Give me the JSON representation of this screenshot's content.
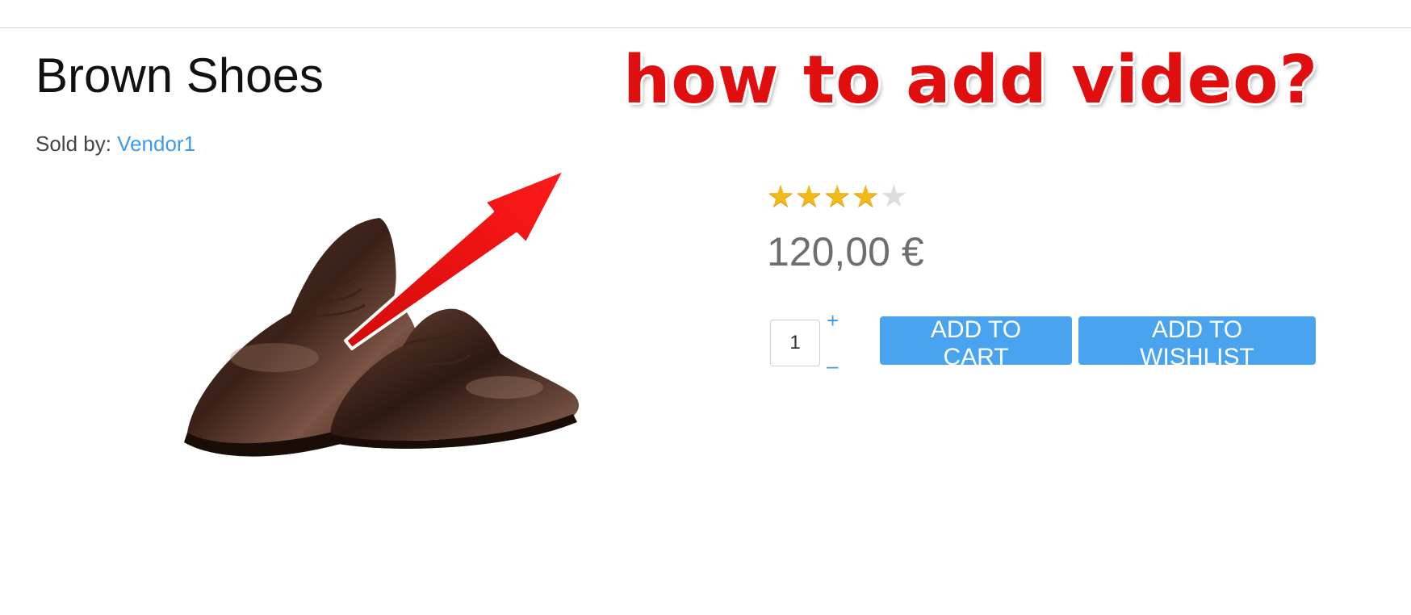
{
  "product": {
    "title": "Brown Shoes",
    "sold_by_label": "Sold by: ",
    "vendor": "Vendor1",
    "rating": 4,
    "rating_max": 5,
    "price": "120,00 €"
  },
  "annotation": {
    "text": "how to add video?",
    "color": "#e00e0e"
  },
  "cart": {
    "quantity": "1",
    "plus": "+",
    "minus": "–",
    "add_to_cart": "ADD TO CART",
    "add_to_wishlist": "ADD TO WISHLIST"
  },
  "colors": {
    "accent": "#4aa3ee",
    "link": "#3d9be8",
    "star": "#f2b918"
  }
}
